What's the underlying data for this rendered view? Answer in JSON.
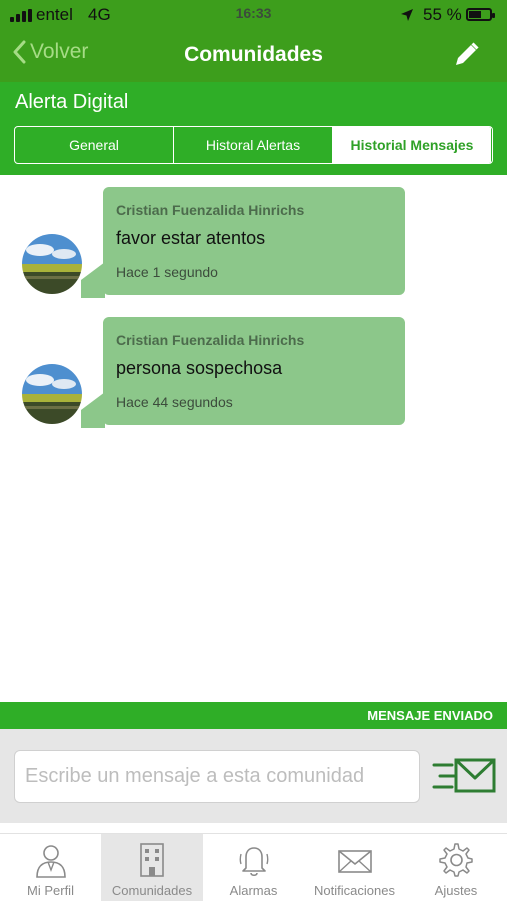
{
  "status_bar": {
    "carrier": "entel",
    "network": "4G",
    "time": "16:33",
    "battery": "55 %",
    "battery_level": 0.55
  },
  "nav": {
    "back_label": "Volver",
    "title": "Comunidades",
    "edit_icon": "pencil-icon"
  },
  "community": {
    "name": "Alerta Digital"
  },
  "tabs": [
    {
      "label": "General",
      "active": false
    },
    {
      "label": "Historal Alertas",
      "active": false
    },
    {
      "label": "Historial Mensajes",
      "active": true
    }
  ],
  "messages": [
    {
      "sender": "Cristian Fuenzalida Hinrichs",
      "text": "favor estar atentos",
      "time": "Hace 1 segundo"
    },
    {
      "sender": "Cristian Fuenzalida Hinrichs",
      "text": "persona sospechosa",
      "time": "Hace 44 segundos"
    }
  ],
  "banner": {
    "text": "MENSAJE ENVIADO"
  },
  "composer": {
    "placeholder": "Escribe un mensaje a esta comunidad",
    "value": "",
    "send_icon": "send-envelope-icon"
  },
  "tab_bar": [
    {
      "label": "Mi Perfil",
      "icon": "profile-icon",
      "active": false
    },
    {
      "label": "Comunidades",
      "icon": "building-icon",
      "active": true
    },
    {
      "label": "Alarmas",
      "icon": "bell-icon",
      "active": false
    },
    {
      "label": "Notificaciones",
      "icon": "envelope-icon",
      "active": false
    },
    {
      "label": "Ajustes",
      "icon": "gear-icon",
      "active": false
    }
  ],
  "colors": {
    "primary_green": "#3d9e1c",
    "secondary_green": "#2fae27",
    "bubble_green": "#8cc78a",
    "back_text": "#a6dc86"
  }
}
